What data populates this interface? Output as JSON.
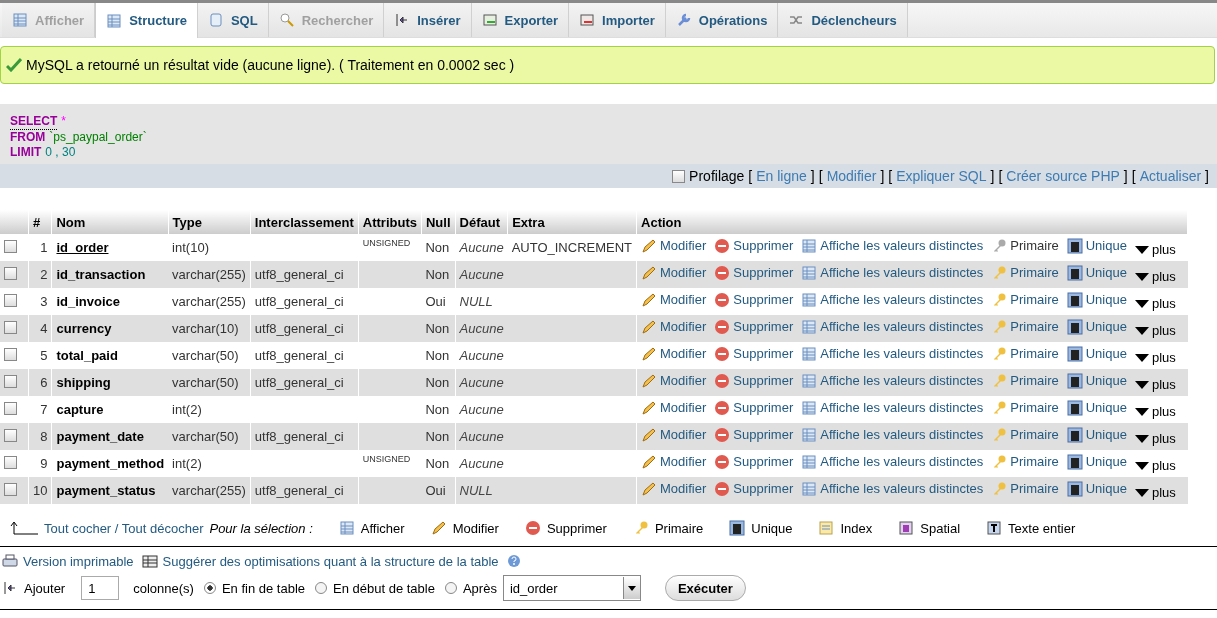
{
  "tabs": [
    {
      "label": "Afficher",
      "kind": "browse",
      "selected": false,
      "disabled": true
    },
    {
      "label": "Structure",
      "kind": "structure",
      "selected": true,
      "disabled": false
    },
    {
      "label": "SQL",
      "kind": "sql",
      "selected": false,
      "disabled": false
    },
    {
      "label": "Rechercher",
      "kind": "search",
      "selected": false,
      "disabled": true
    },
    {
      "label": "Insérer",
      "kind": "insert",
      "selected": false,
      "disabled": false
    },
    {
      "label": "Exporter",
      "kind": "export",
      "selected": false,
      "disabled": false
    },
    {
      "label": "Importer",
      "kind": "import",
      "selected": false,
      "disabled": false
    },
    {
      "label": "Opérations",
      "kind": "operations",
      "selected": false,
      "disabled": false
    },
    {
      "label": "Déclencheurs",
      "kind": "triggers",
      "selected": false,
      "disabled": false
    }
  ],
  "message": {
    "text": "MySQL a retourné un résultat vide (aucune ligne). ( Traitement en 0.0002 sec )"
  },
  "sql": {
    "lines": [
      {
        "keyword": "SELECT",
        "value": "*",
        "kind": "operator"
      },
      {
        "keyword": "FROM",
        "value": "`ps_paypal_order`",
        "kind": "identifier"
      },
      {
        "keyword": "LIMIT",
        "value": "0 , 30",
        "kind": "number"
      }
    ],
    "profiling": {
      "label": "Profilage",
      "checked": false
    },
    "links": [
      {
        "before": "[",
        "label": "En ligne",
        "after": "]"
      },
      {
        "before": "[",
        "label": "Modifier",
        "after": "]"
      },
      {
        "before": "[",
        "label": "Expliquer SQL",
        "after": "]"
      },
      {
        "before": "[",
        "label": "Créer source PHP",
        "after": "]"
      },
      {
        "before": "[",
        "label": "Actualiser",
        "after": "]"
      }
    ]
  },
  "table": {
    "columns": [
      "#",
      "Nom",
      "Type",
      "Interclassement",
      "Attributs",
      "Null",
      "Défaut",
      "Extra",
      "Action"
    ],
    "rows": [
      {
        "number": "1",
        "name": "id_order",
        "primary": true,
        "type": "int(10)",
        "collation": "",
        "attributes": "UNSIGNED",
        "null": "Non",
        "default": "Aucune",
        "extra": "AUTO_INCREMENT",
        "checked": false,
        "actions": [
          {
            "kind": "edit",
            "label": "Modifier",
            "disabled": false
          },
          {
            "kind": "drop",
            "label": "Supprimer",
            "disabled": false
          },
          {
            "kind": "browse",
            "label": "Affiche les valeurs distinctes",
            "disabled": false
          },
          {
            "kind": "primary",
            "label": "Primaire",
            "disabled": true
          },
          {
            "kind": "unique",
            "label": "Unique",
            "disabled": false
          },
          {
            "kind": "more",
            "label": "plus",
            "disabled": false
          }
        ]
      },
      {
        "number": "2",
        "name": "id_transaction",
        "primary": false,
        "type": "varchar(255)",
        "collation": "utf8_general_ci",
        "attributes": "",
        "null": "Non",
        "default": "Aucune",
        "extra": "",
        "checked": false,
        "actions": [
          {
            "kind": "edit",
            "label": "Modifier",
            "disabled": false
          },
          {
            "kind": "drop",
            "label": "Supprimer",
            "disabled": false
          },
          {
            "kind": "browse",
            "label": "Affiche les valeurs distinctes",
            "disabled": false
          },
          {
            "kind": "primary",
            "label": "Primaire",
            "disabled": false
          },
          {
            "kind": "unique",
            "label": "Unique",
            "disabled": false
          },
          {
            "kind": "more",
            "label": "plus",
            "disabled": false
          }
        ]
      },
      {
        "number": "3",
        "name": "id_invoice",
        "primary": false,
        "type": "varchar(255)",
        "collation": "utf8_general_ci",
        "attributes": "",
        "null": "Oui",
        "default": "NULL",
        "extra": "",
        "checked": false,
        "actions": [
          {
            "kind": "edit",
            "label": "Modifier",
            "disabled": false
          },
          {
            "kind": "drop",
            "label": "Supprimer",
            "disabled": false
          },
          {
            "kind": "browse",
            "label": "Affiche les valeurs distinctes",
            "disabled": false
          },
          {
            "kind": "primary",
            "label": "Primaire",
            "disabled": false
          },
          {
            "kind": "unique",
            "label": "Unique",
            "disabled": false
          },
          {
            "kind": "more",
            "label": "plus",
            "disabled": false
          }
        ]
      },
      {
        "number": "4",
        "name": "currency",
        "primary": false,
        "type": "varchar(10)",
        "collation": "utf8_general_ci",
        "attributes": "",
        "null": "Non",
        "default": "Aucune",
        "extra": "",
        "checked": false,
        "actions": [
          {
            "kind": "edit",
            "label": "Modifier",
            "disabled": false
          },
          {
            "kind": "drop",
            "label": "Supprimer",
            "disabled": false
          },
          {
            "kind": "browse",
            "label": "Affiche les valeurs distinctes",
            "disabled": false
          },
          {
            "kind": "primary",
            "label": "Primaire",
            "disabled": false
          },
          {
            "kind": "unique",
            "label": "Unique",
            "disabled": false
          },
          {
            "kind": "more",
            "label": "plus",
            "disabled": false
          }
        ]
      },
      {
        "number": "5",
        "name": "total_paid",
        "primary": false,
        "type": "varchar(50)",
        "collation": "utf8_general_ci",
        "attributes": "",
        "null": "Non",
        "default": "Aucune",
        "extra": "",
        "checked": false,
        "actions": [
          {
            "kind": "edit",
            "label": "Modifier",
            "disabled": false
          },
          {
            "kind": "drop",
            "label": "Supprimer",
            "disabled": false
          },
          {
            "kind": "browse",
            "label": "Affiche les valeurs distinctes",
            "disabled": false
          },
          {
            "kind": "primary",
            "label": "Primaire",
            "disabled": false
          },
          {
            "kind": "unique",
            "label": "Unique",
            "disabled": false
          },
          {
            "kind": "more",
            "label": "plus",
            "disabled": false
          }
        ]
      },
      {
        "number": "6",
        "name": "shipping",
        "primary": false,
        "type": "varchar(50)",
        "collation": "utf8_general_ci",
        "attributes": "",
        "null": "Non",
        "default": "Aucune",
        "extra": "",
        "checked": false,
        "actions": [
          {
            "kind": "edit",
            "label": "Modifier",
            "disabled": false
          },
          {
            "kind": "drop",
            "label": "Supprimer",
            "disabled": false
          },
          {
            "kind": "browse",
            "label": "Affiche les valeurs distinctes",
            "disabled": false
          },
          {
            "kind": "primary",
            "label": "Primaire",
            "disabled": false
          },
          {
            "kind": "unique",
            "label": "Unique",
            "disabled": false
          },
          {
            "kind": "more",
            "label": "plus",
            "disabled": false
          }
        ]
      },
      {
        "number": "7",
        "name": "capture",
        "primary": false,
        "type": "int(2)",
        "collation": "",
        "attributes": "",
        "null": "Non",
        "default": "Aucune",
        "extra": "",
        "checked": false,
        "actions": [
          {
            "kind": "edit",
            "label": "Modifier",
            "disabled": false
          },
          {
            "kind": "drop",
            "label": "Supprimer",
            "disabled": false
          },
          {
            "kind": "browse",
            "label": "Affiche les valeurs distinctes",
            "disabled": false
          },
          {
            "kind": "primary",
            "label": "Primaire",
            "disabled": false
          },
          {
            "kind": "unique",
            "label": "Unique",
            "disabled": false
          },
          {
            "kind": "more",
            "label": "plus",
            "disabled": false
          }
        ]
      },
      {
        "number": "8",
        "name": "payment_date",
        "primary": false,
        "type": "varchar(50)",
        "collation": "utf8_general_ci",
        "attributes": "",
        "null": "Non",
        "default": "Aucune",
        "extra": "",
        "checked": false,
        "actions": [
          {
            "kind": "edit",
            "label": "Modifier",
            "disabled": false
          },
          {
            "kind": "drop",
            "label": "Supprimer",
            "disabled": false
          },
          {
            "kind": "browse",
            "label": "Affiche les valeurs distinctes",
            "disabled": false
          },
          {
            "kind": "primary",
            "label": "Primaire",
            "disabled": false
          },
          {
            "kind": "unique",
            "label": "Unique",
            "disabled": false
          },
          {
            "kind": "more",
            "label": "plus",
            "disabled": false
          }
        ]
      },
      {
        "number": "9",
        "name": "payment_method",
        "primary": false,
        "type": "int(2)",
        "collation": "",
        "attributes": "UNSIGNED",
        "null": "Non",
        "default": "Aucune",
        "extra": "",
        "checked": false,
        "actions": [
          {
            "kind": "edit",
            "label": "Modifier",
            "disabled": false
          },
          {
            "kind": "drop",
            "label": "Supprimer",
            "disabled": false
          },
          {
            "kind": "browse",
            "label": "Affiche les valeurs distinctes",
            "disabled": false
          },
          {
            "kind": "primary",
            "label": "Primaire",
            "disabled": false
          },
          {
            "kind": "unique",
            "label": "Unique",
            "disabled": false
          },
          {
            "kind": "more",
            "label": "plus",
            "disabled": false
          }
        ]
      },
      {
        "number": "10",
        "name": "payment_status",
        "primary": false,
        "type": "varchar(255)",
        "collation": "utf8_general_ci",
        "attributes": "",
        "null": "Oui",
        "default": "NULL",
        "extra": "",
        "checked": false,
        "actions": [
          {
            "kind": "edit",
            "label": "Modifier",
            "disabled": false
          },
          {
            "kind": "drop",
            "label": "Supprimer",
            "disabled": false
          },
          {
            "kind": "browse",
            "label": "Affiche les valeurs distinctes",
            "disabled": false
          },
          {
            "kind": "primary",
            "label": "Primaire",
            "disabled": false
          },
          {
            "kind": "unique",
            "label": "Unique",
            "disabled": false
          },
          {
            "kind": "more",
            "label": "plus",
            "disabled": false
          }
        ]
      }
    ]
  },
  "selection": {
    "check_all": "Tout cocher / Tout décocher",
    "with_selected": "Pour la sélection :",
    "actions": [
      {
        "kind": "browse",
        "label": "Afficher"
      },
      {
        "kind": "edit",
        "label": "Modifier"
      },
      {
        "kind": "drop",
        "label": "Supprimer"
      },
      {
        "kind": "primary",
        "label": "Primaire"
      },
      {
        "kind": "unique",
        "label": "Unique"
      },
      {
        "kind": "index",
        "label": "Index"
      },
      {
        "kind": "spatial",
        "label": "Spatial"
      },
      {
        "kind": "fulltext",
        "label": "Texte entier"
      }
    ]
  },
  "footer_links": [
    {
      "kind": "print",
      "label": "Version imprimable"
    },
    {
      "kind": "propose",
      "label": "Suggérer des optimisations quant à la structure de la table"
    }
  ],
  "add_column": {
    "label": "Ajouter",
    "count": "1",
    "unit": "colonne(s)",
    "positions": [
      {
        "label": "En fin de table",
        "selected": true
      },
      {
        "label": "En début de table",
        "selected": false
      },
      {
        "label": "Après",
        "selected": false
      }
    ],
    "after_field": "id_order",
    "button": "Exécuter"
  }
}
